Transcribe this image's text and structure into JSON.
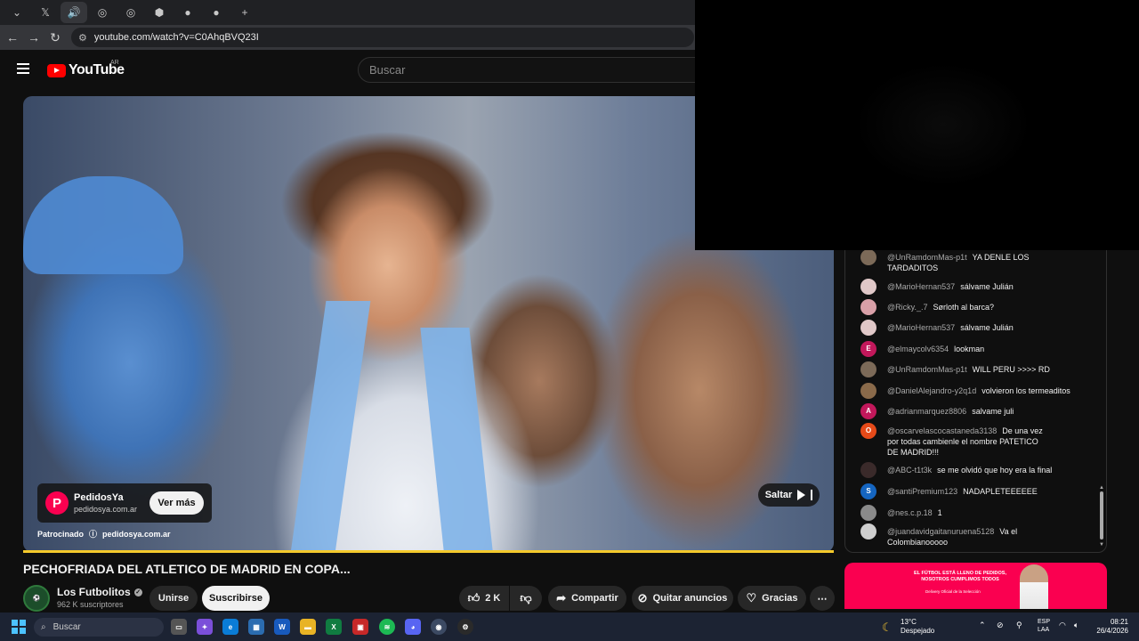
{
  "browser": {
    "tabs": [
      {
        "icon": "chevron-down-icon",
        "glyph": "⌄"
      },
      {
        "icon": "x-logo-icon",
        "glyph": "𝕏"
      },
      {
        "icon": "speaker-icon",
        "glyph": "🔊"
      },
      {
        "icon": "tab-icon",
        "glyph": "◎"
      },
      {
        "icon": "tab-icon",
        "glyph": "◎"
      },
      {
        "icon": "tab-icon",
        "glyph": "⬢"
      },
      {
        "icon": "tab-icon",
        "glyph": "●"
      },
      {
        "icon": "tab-icon",
        "glyph": "●"
      }
    ],
    "new_tab": "+",
    "url": "youtube.com/watch?v=C0AhqBVQ23I"
  },
  "youtube": {
    "logo_text": "YouTube",
    "country": "AR",
    "search_placeholder": "Buscar"
  },
  "ad": {
    "logo_letter": "P",
    "name": "PedidosYa",
    "domain": "pedidosya.com.ar",
    "cta": "Ver más",
    "sponsored_label": "Patrocinado",
    "sponsored_info": "ⓘ",
    "sponsored_domain": "pedidosya.com.ar",
    "skip_label": "Saltar"
  },
  "video": {
    "title": "PECHOFRIADA DEL ATLETICO DE MADRID EN COPA...",
    "channel_name": "Los Futbolitos",
    "subscribers": "962 K suscriptores",
    "join_label": "Unirse",
    "subscribe_label": "Suscribirse",
    "likes": "2 K",
    "share_label": "Compartir",
    "remove_ads_label": "Quitar anuncios",
    "thanks_label": "Gracias",
    "more": "⋯"
  },
  "chat": {
    "messages": [
      {
        "user": "@UnRamdomMas-p1t",
        "text": "YA DENLE LOS TARDADITOS",
        "avatar_color": "#7c6a58",
        "avatar_letter": ""
      },
      {
        "user": "@MarioHernan537",
        "text": "sálvame Julián",
        "avatar_color": "#e0c8c8",
        "avatar_letter": ""
      },
      {
        "user": "@Ricky._.7",
        "text": "Sørloth al barca?",
        "avatar_color": "#d9a0a8",
        "avatar_letter": ""
      },
      {
        "user": "@MarioHernan537",
        "text": "sálvame Julián",
        "avatar_color": "#e0c8c8",
        "avatar_letter": ""
      },
      {
        "user": "@elmaycolv6354",
        "text": "lookman",
        "avatar_color": "#c2185b",
        "avatar_letter": "E"
      },
      {
        "user": "@UnRamdomMas-p1t",
        "text": "WILL PERU >>>> RD",
        "avatar_color": "#7c6a58",
        "avatar_letter": ""
      },
      {
        "user": "@DanielAlejandro-y2q1d",
        "text": "volvieron los termeaditos",
        "avatar_color": "#8a6a4a",
        "avatar_letter": ""
      },
      {
        "user": "@adrianmarquez8806",
        "text": "salvame juli",
        "avatar_color": "#c2185b",
        "avatar_letter": "A"
      },
      {
        "user": "@oscarvelascocastaneda3138",
        "text": "De una vez por todas cambienle el nombre PATETICO DE MADRID!!!",
        "avatar_color": "#e64a19",
        "avatar_letter": "O"
      },
      {
        "user": "@ABC-t1t3k",
        "text": "se me olvidó que hoy era la final",
        "avatar_color": "#3a2a2a",
        "avatar_letter": ""
      },
      {
        "user": "@santiPremium123",
        "text": "NADAPLETEEEEEE",
        "avatar_color": "#1565c0",
        "avatar_letter": "S"
      },
      {
        "user": "@nes.c.p.18",
        "text": "1",
        "avatar_color": "#8a8a8a",
        "avatar_letter": ""
      },
      {
        "user": "@juandavidgaitanuruena5128",
        "text": "Va el Colombianooooo",
        "avatar_color": "#cfcfcf",
        "avatar_letter": ""
      }
    ]
  },
  "banner": {
    "headline": "EL FÚTBOL ESTÁ LLENO DE PEDIDOS, NOSOTROS CUMPLIMOS TODOS",
    "sub": "Delivery Oficial de la Selección"
  },
  "taskbar": {
    "search_placeholder": "Buscar",
    "weather_temp": "13°C",
    "weather_desc": "Despejado",
    "lang": "ESP",
    "lang_sub": "LAA",
    "time": "08:21",
    "date": "26/4/2026"
  },
  "colors": {
    "youtube_red": "#ff0000",
    "pedidosya_red": "#fa0050",
    "ad_progress": "#f4c92b"
  }
}
